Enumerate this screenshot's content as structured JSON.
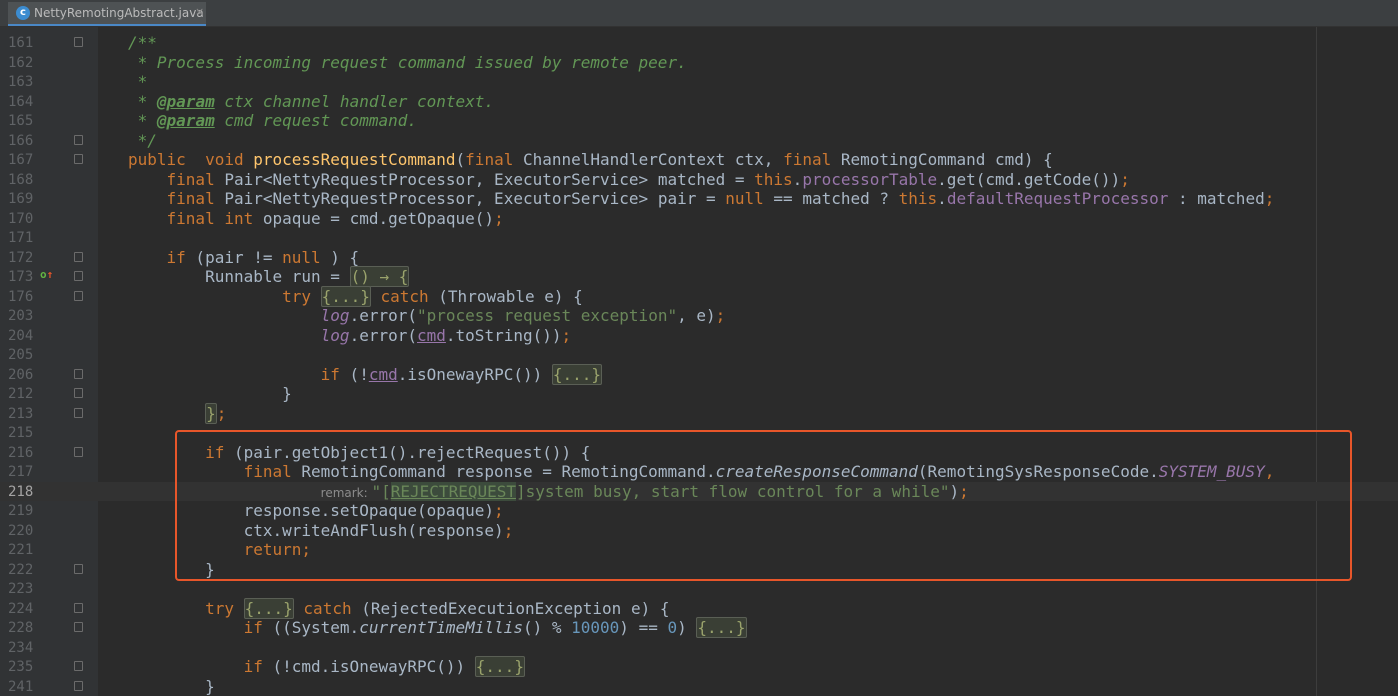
{
  "tab": {
    "filename": "NettyRemotingAbstract.java",
    "icon": "java-class-icon",
    "close": "×"
  },
  "colors": {
    "background": "#2b2b2b",
    "keyword": "#cc7832",
    "string": "#6a8759",
    "number": "#6897bb",
    "field": "#9876aa",
    "method_decl": "#ffc66d",
    "javadoc": "#629755",
    "highlight_box": "#e8562a"
  },
  "lines": [
    {
      "n": "161",
      "fold": true,
      "s": [
        [
          "doc",
          "/**"
        ]
      ]
    },
    {
      "n": "162",
      "s": [
        [
          "doc",
          " * Process incoming request command issued by remote peer."
        ]
      ]
    },
    {
      "n": "163",
      "s": [
        [
          "doc",
          " *"
        ]
      ]
    },
    {
      "n": "164",
      "s": [
        [
          "doc",
          " * "
        ],
        [
          "tag",
          "@param"
        ],
        [
          "doc",
          " ctx channel handler context."
        ]
      ]
    },
    {
      "n": "165",
      "s": [
        [
          "doc",
          " * "
        ],
        [
          "tag",
          "@param"
        ],
        [
          "doc",
          " cmd request command."
        ]
      ]
    },
    {
      "n": "166",
      "fold": true,
      "s": [
        [
          "doc",
          " */"
        ]
      ]
    },
    {
      "n": "167",
      "fold": true,
      "s": [
        [
          "kw",
          "public"
        ],
        [
          "",
          "  "
        ],
        [
          "kw",
          "void"
        ],
        [
          "",
          " "
        ],
        [
          "fn",
          "processRequestCommand"
        ],
        [
          "",
          "("
        ],
        [
          "kw",
          "final"
        ],
        [
          "",
          " ChannelHandlerContext ctx, "
        ],
        [
          "kw",
          "final"
        ],
        [
          "",
          " RemotingCommand cmd) {"
        ]
      ]
    },
    {
      "n": "168",
      "s": [
        [
          "",
          "    "
        ],
        [
          "kw",
          "final"
        ],
        [
          "",
          " Pair<NettyRequestProcessor, ExecutorService> matched = "
        ],
        [
          "kw",
          "this"
        ],
        [
          "",
          "."
        ],
        [
          "fld",
          "processorTable"
        ],
        [
          "",
          ".get(cmd.getCode())"
        ],
        [
          "kw",
          ";"
        ]
      ]
    },
    {
      "n": "169",
      "s": [
        [
          "",
          "    "
        ],
        [
          "kw",
          "final"
        ],
        [
          "",
          " Pair<NettyRequestProcessor, ExecutorService> pair = "
        ],
        [
          "kw",
          "null"
        ],
        [
          "",
          " == matched ? "
        ],
        [
          "kw",
          "this"
        ],
        [
          "",
          "."
        ],
        [
          "fld",
          "defaultRequestProcessor"
        ],
        [
          "",
          " : matched"
        ],
        [
          "kw",
          ";"
        ]
      ]
    },
    {
      "n": "170",
      "s": [
        [
          "",
          "    "
        ],
        [
          "kw",
          "final int"
        ],
        [
          "",
          " opaque = cmd.getOpaque()"
        ],
        [
          "kw",
          ";"
        ]
      ]
    },
    {
      "n": "171",
      "s": []
    },
    {
      "n": "172",
      "fold": true,
      "s": [
        [
          "",
          "    "
        ],
        [
          "kw",
          "if"
        ],
        [
          "",
          " (pair != "
        ],
        [
          "kw",
          "null"
        ],
        [
          "",
          " ) {"
        ]
      ]
    },
    {
      "n": "173",
      "fold": true,
      "s": [
        [
          "",
          "        Runnable run = "
        ],
        [
          "foldbox",
          "() → {"
        ]
      ]
    },
    {
      "n": "176",
      "fold": true,
      "s": [
        [
          "",
          "                "
        ],
        [
          "kw",
          "try"
        ],
        [
          "",
          " "
        ],
        [
          "foldbox",
          "{...}"
        ],
        [
          "",
          " "
        ],
        [
          "kw",
          "catch"
        ],
        [
          "",
          " (Throwable e) {"
        ]
      ]
    },
    {
      "n": "203",
      "s": [
        [
          "",
          "                    "
        ],
        [
          "fld it",
          "log"
        ],
        [
          "",
          ".error("
        ],
        [
          "str",
          "\"process request exception\""
        ],
        [
          "",
          ", e)"
        ],
        [
          "kw",
          ";"
        ]
      ]
    },
    {
      "n": "204",
      "s": [
        [
          "",
          "                    "
        ],
        [
          "fld it",
          "log"
        ],
        [
          "",
          ".error("
        ],
        [
          "fld ul",
          "cmd"
        ],
        [
          "",
          ".toString())"
        ],
        [
          "kw",
          ";"
        ]
      ]
    },
    {
      "n": "205",
      "s": []
    },
    {
      "n": "206",
      "fold": true,
      "s": [
        [
          "",
          "                    "
        ],
        [
          "kw",
          "if"
        ],
        [
          "",
          " (!"
        ],
        [
          "fld ul",
          "cmd"
        ],
        [
          "",
          ".isOnewayRPC()) "
        ],
        [
          "foldbox",
          "{...}"
        ]
      ]
    },
    {
      "n": "212",
      "fold": true,
      "s": [
        [
          "",
          "                }"
        ]
      ]
    },
    {
      "n": "213",
      "fold": true,
      "s": [
        [
          "",
          "        "
        ],
        [
          "foldbox",
          "}"
        ],
        [
          "kw",
          ";"
        ]
      ]
    },
    {
      "n": "215",
      "s": []
    },
    {
      "n": "216",
      "fold": true,
      "s": [
        [
          "",
          "        "
        ],
        [
          "kw",
          "if"
        ],
        [
          "",
          " (pair.getObject1().rejectRequest()) {"
        ]
      ]
    },
    {
      "n": "217",
      "s": [
        [
          "",
          "            "
        ],
        [
          "kw",
          "final"
        ],
        [
          "",
          " RemotingCommand response = RemotingCommand."
        ],
        [
          "it",
          "createResponseCommand"
        ],
        [
          "",
          "(RemotingSysResponseCode."
        ],
        [
          "fld it",
          "SYSTEM_BUSY"
        ],
        [
          "kw",
          ","
        ]
      ]
    },
    {
      "n": "218",
      "current": true,
      "s": [
        [
          "",
          "                    "
        ],
        [
          "hint",
          "remark: "
        ],
        [
          "str",
          "\"["
        ],
        [
          "str hl",
          "REJECTREQUEST"
        ],
        [
          "str",
          "]system busy, start flow control for a while\""
        ],
        [
          "",
          ")"
        ],
        [
          "kw",
          ";"
        ]
      ]
    },
    {
      "n": "219",
      "s": [
        [
          "",
          "            response.setOpaque(opaque)"
        ],
        [
          "kw",
          ";"
        ]
      ]
    },
    {
      "n": "220",
      "s": [
        [
          "",
          "            ctx.writeAndFlush(response)"
        ],
        [
          "kw",
          ";"
        ]
      ]
    },
    {
      "n": "221",
      "s": [
        [
          "",
          "            "
        ],
        [
          "kw",
          "return;"
        ]
      ]
    },
    {
      "n": "222",
      "fold": true,
      "s": [
        [
          "",
          "        }"
        ]
      ]
    },
    {
      "n": "223",
      "s": []
    },
    {
      "n": "224",
      "fold": true,
      "s": [
        [
          "",
          "        "
        ],
        [
          "kw",
          "try"
        ],
        [
          "",
          " "
        ],
        [
          "foldbox",
          "{...}"
        ],
        [
          "",
          " "
        ],
        [
          "kw",
          "catch"
        ],
        [
          "",
          " (RejectedExecutionException e) {"
        ]
      ]
    },
    {
      "n": "228",
      "fold": true,
      "s": [
        [
          "",
          "            "
        ],
        [
          "kw",
          "if"
        ],
        [
          "",
          " ((System."
        ],
        [
          "it",
          "currentTimeMillis"
        ],
        [
          "",
          "() % "
        ],
        [
          "num",
          "10000"
        ],
        [
          "",
          ") == "
        ],
        [
          "num",
          "0"
        ],
        [
          "",
          ") "
        ],
        [
          "foldbox",
          "{...}"
        ]
      ]
    },
    {
      "n": "234",
      "s": []
    },
    {
      "n": "235",
      "fold": true,
      "s": [
        [
          "",
          "            "
        ],
        [
          "kw",
          "if"
        ],
        [
          "",
          " (!cmd.isOnewayRPC()) "
        ],
        [
          "foldbox",
          "{...}"
        ]
      ]
    },
    {
      "n": "241",
      "fold": true,
      "s": [
        [
          "",
          "        }"
        ]
      ]
    }
  ]
}
